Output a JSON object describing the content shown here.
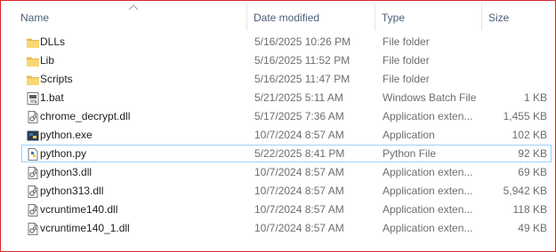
{
  "columns": {
    "name": "Name",
    "date_modified": "Date modified",
    "type": "Type",
    "size": "Size"
  },
  "rows": [
    {
      "icon": "folder-icon",
      "name": "DLLs",
      "date": "5/16/2025 10:26 PM",
      "type": "File folder",
      "size": ""
    },
    {
      "icon": "folder-icon",
      "name": "Lib",
      "date": "5/16/2025 11:52 PM",
      "type": "File folder",
      "size": ""
    },
    {
      "icon": "folder-icon",
      "name": "Scripts",
      "date": "5/16/2025 11:47 PM",
      "type": "File folder",
      "size": ""
    },
    {
      "icon": "batch-file-icon",
      "name": "1.bat",
      "date": "5/21/2025 5:11 AM",
      "type": "Windows Batch File",
      "size": "1 KB"
    },
    {
      "icon": "dll-file-icon",
      "name": "chrome_decrypt.dll",
      "date": "5/17/2025 7:36 AM",
      "type": "Application exten...",
      "size": "1,455 KB"
    },
    {
      "icon": "python-exe-icon",
      "name": "python.exe",
      "date": "10/7/2024 8:57 AM",
      "type": "Application",
      "size": "102 KB"
    },
    {
      "icon": "python-file-icon",
      "name": "python.py",
      "date": "5/22/2025 8:41 PM",
      "type": "Python File",
      "size": "92 KB",
      "selected": true
    },
    {
      "icon": "dll-file-icon",
      "name": "python3.dll",
      "date": "10/7/2024 8:57 AM",
      "type": "Application exten...",
      "size": "69 KB"
    },
    {
      "icon": "dll-file-icon",
      "name": "python313.dll",
      "date": "10/7/2024 8:57 AM",
      "type": "Application exten...",
      "size": "5,942 KB"
    },
    {
      "icon": "dll-file-icon",
      "name": "vcruntime140.dll",
      "date": "10/7/2024 8:57 AM",
      "type": "Application exten...",
      "size": "118 KB"
    },
    {
      "icon": "dll-file-icon",
      "name": "vcruntime140_1.dll",
      "date": "10/7/2024 8:57 AM",
      "type": "Application exten...",
      "size": "49 KB"
    }
  ],
  "colors": {
    "header_text": "#4c607a",
    "selection_border": "#99d1ff",
    "folder_yellow": "#f8d775",
    "frame_border": "#d9262b"
  }
}
